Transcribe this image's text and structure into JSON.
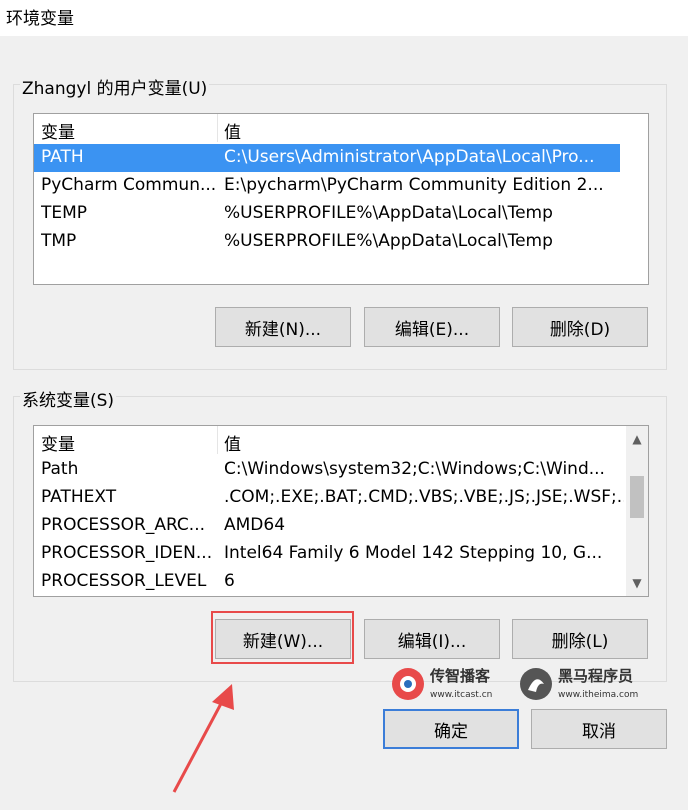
{
  "window": {
    "title": "环境变量"
  },
  "user_vars": {
    "group_label": "Zhangyl 的用户变量(U)",
    "col_name": "变量",
    "col_value": "值",
    "rows": [
      {
        "name": "PATH",
        "value": "C:\\Users\\Administrator\\AppData\\Local\\Pro...",
        "selected": true
      },
      {
        "name": "PyCharm Commun...",
        "value": "E:\\pycharm\\PyCharm Community Edition 2..."
      },
      {
        "name": "TEMP",
        "value": "%USERPROFILE%\\AppData\\Local\\Temp"
      },
      {
        "name": "TMP",
        "value": "%USERPROFILE%\\AppData\\Local\\Temp"
      }
    ],
    "btn_new": "新建(N)...",
    "btn_edit": "编辑(E)...",
    "btn_delete": "删除(D)"
  },
  "sys_vars": {
    "group_label": "系统变量(S)",
    "col_name": "变量",
    "col_value": "值",
    "rows": [
      {
        "name": "Path",
        "value": "C:\\Windows\\system32;C:\\Windows;C:\\Wind..."
      },
      {
        "name": "PATHEXT",
        "value": ".COM;.EXE;.BAT;.CMD;.VBS;.VBE;.JS;.JSE;.WSF;..."
      },
      {
        "name": "PROCESSOR_ARC...",
        "value": "AMD64"
      },
      {
        "name": "PROCESSOR_IDEN...",
        "value": "Intel64 Family 6 Model 142 Stepping 10, G..."
      },
      {
        "name": "PROCESSOR_LEVEL",
        "value": "6"
      }
    ],
    "btn_new": "新建(W)...",
    "btn_edit": "编辑(I)...",
    "btn_delete": "删除(L)"
  },
  "footer": {
    "btn_ok": "确定",
    "btn_cancel": "取消"
  },
  "watermark": {
    "brand1_name": "传智播客",
    "brand1_url": "www.itcast.cn",
    "brand2_name": "黑马程序员",
    "brand2_url": "www.itheima.com"
  },
  "colors": {
    "selection": "#3b93f2",
    "annotation": "#e84a4a"
  }
}
